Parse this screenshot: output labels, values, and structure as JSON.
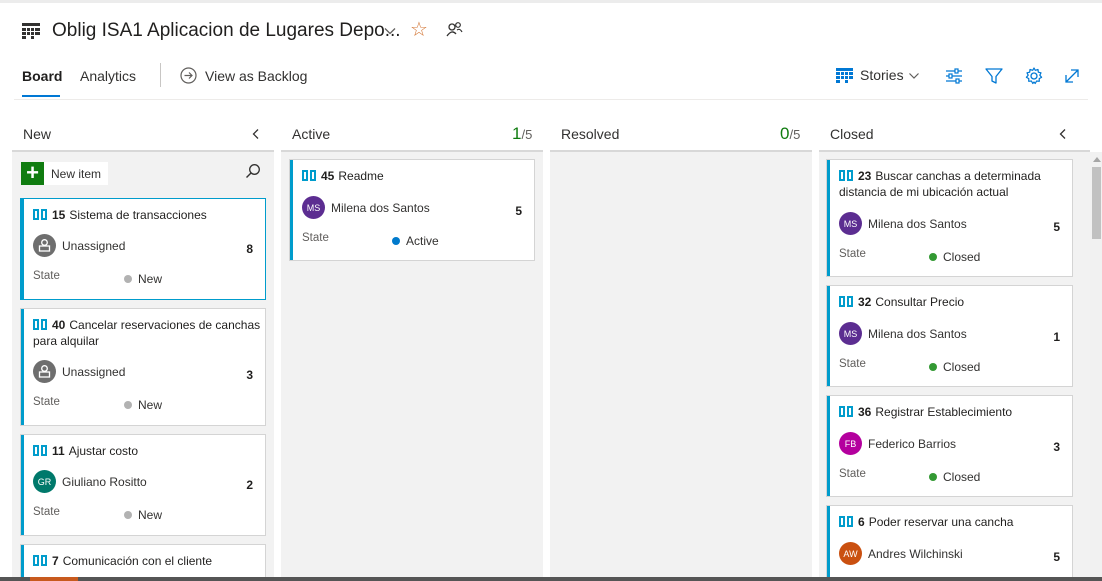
{
  "header": {
    "title": "Oblig ISA1 Aplicacion de Lugares Depo...",
    "tabs": {
      "board": "Board",
      "analytics": "Analytics"
    },
    "view_as_backlog": "View as Backlog",
    "level_selector": "Stories"
  },
  "columns": {
    "new": {
      "label": "New"
    },
    "active": {
      "label": "Active",
      "count": "1",
      "limit": "/5"
    },
    "resolved": {
      "label": "Resolved",
      "count": "0",
      "limit": "/5"
    },
    "closed": {
      "label": "Closed"
    }
  },
  "new_item_label": "New item",
  "cards": {
    "c15": {
      "id": "15",
      "title": "Sistema de transacciones",
      "assignee": "Unassigned",
      "points": "8",
      "state_label": "State",
      "state": "New"
    },
    "c40": {
      "id": "40",
      "title": "Cancelar reservaciones de canchas para alquilar",
      "assignee": "Unassigned",
      "points": "3",
      "state_label": "State",
      "state": "New"
    },
    "c11": {
      "id": "11",
      "title": "Ajustar costo",
      "assignee": "Giuliano Rositto",
      "initials": "GR",
      "points": "2",
      "state_label": "State",
      "state": "New"
    },
    "c7": {
      "id": "7",
      "title": "Comunicación con el cliente"
    },
    "c45": {
      "id": "45",
      "title": "Readme",
      "assignee": "Milena dos Santos",
      "initials": "MS",
      "points": "5",
      "state_label": "State",
      "state": "Active"
    },
    "c23": {
      "id": "23",
      "title": "Buscar canchas a determinada distancia de mi ubicación actual",
      "assignee": "Milena dos Santos",
      "initials": "MS",
      "points": "5",
      "state_label": "State",
      "state": "Closed"
    },
    "c32": {
      "id": "32",
      "title": "Consultar Precio",
      "assignee": "Milena dos Santos",
      "initials": "MS",
      "points": "1",
      "state_label": "State",
      "state": "Closed"
    },
    "c36": {
      "id": "36",
      "title": "Registrar Establecimiento",
      "assignee": "Federico Barrios",
      "initials": "FB",
      "points": "3",
      "state_label": "State",
      "state": "Closed"
    },
    "c6": {
      "id": "6",
      "title": "Poder reservar una cancha",
      "assignee": "Andres Wilchinski",
      "initials": "AW",
      "points": "5"
    }
  },
  "colors": {
    "card_accent": "#009ccc",
    "state_new": "#b2b2b2",
    "state_active": "#007acc",
    "state_closed": "#339933",
    "avatar_ms": "#5c2d91",
    "avatar_gr": "#00796b",
    "avatar_fb": "#b4009e",
    "avatar_aw": "#ca5010"
  },
  "icons": [
    "board-icon",
    "chevron-down-icon",
    "star-icon",
    "team-icon",
    "arrow-circle-icon",
    "backlog-level-icon",
    "settings-sliders-icon",
    "filter-icon",
    "gear-icon",
    "expand-icon",
    "chevron-left-icon",
    "search-icon",
    "plus-icon",
    "story-book-icon",
    "unassigned-avatar-icon"
  ]
}
